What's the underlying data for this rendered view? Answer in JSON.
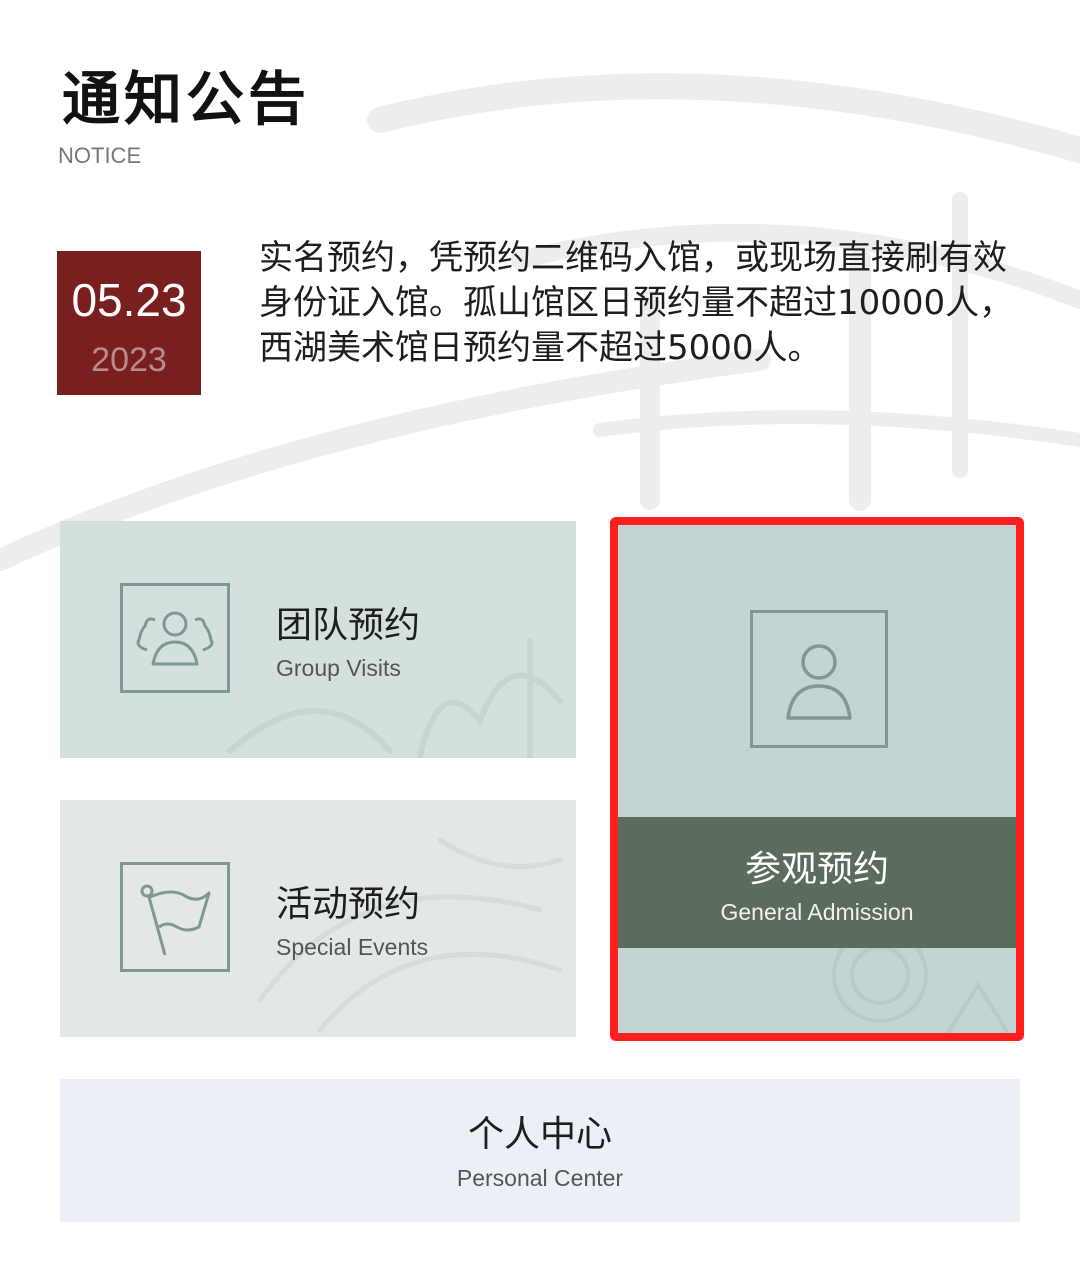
{
  "header": {
    "title": "通知公告",
    "subtitle": "NOTICE"
  },
  "notice": {
    "date_md": "05.23",
    "date_year": "2023",
    "text": "实名预约，凭预约二维码入馆，或现场直接刷有效身份证入馆。孤山馆区日预约量不超过10000人，西湖美术馆日预约量不超过5000人。"
  },
  "cards": {
    "group": {
      "title": "团队预约",
      "subtitle": "Group Visits",
      "icon": "group-icon"
    },
    "event": {
      "title": "活动预约",
      "subtitle": "Special Events",
      "icon": "flag-icon"
    },
    "general": {
      "title": "参观预约",
      "subtitle": "General Admission",
      "icon": "person-icon"
    },
    "personal": {
      "title": "个人中心",
      "subtitle": "Personal Center"
    }
  },
  "colors": {
    "date_bg": "#7a1f1f",
    "highlight_border": "#ff1f1f",
    "general_band": "#5b6b5c",
    "icon_stroke": "#7f9893"
  }
}
